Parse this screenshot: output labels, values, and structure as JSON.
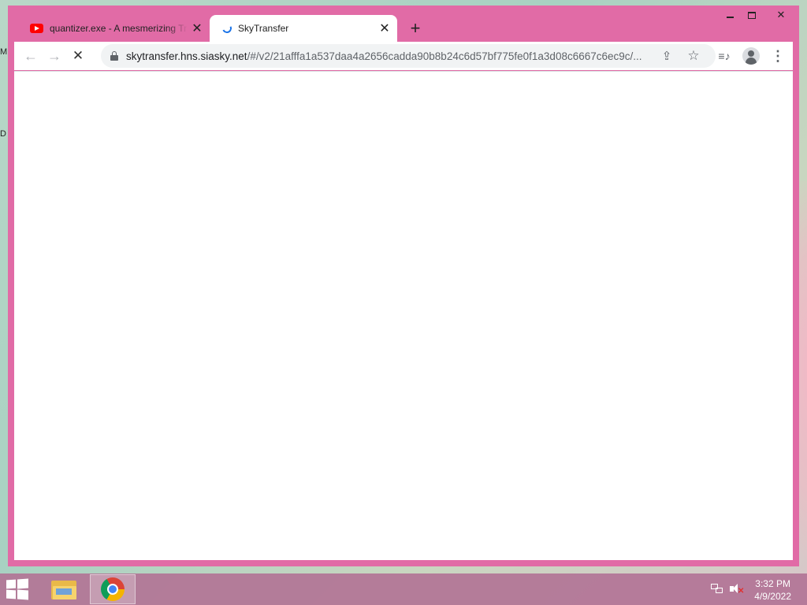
{
  "desktop": {
    "edge_letters": [
      "M",
      "D"
    ]
  },
  "browser": {
    "tabs": [
      {
        "title": "quantizer.exe - A mesmerizing Tr",
        "icon": "youtube-icon",
        "active": false
      },
      {
        "title": "SkyTransfer",
        "icon": "loading-spinner-icon",
        "active": true
      }
    ],
    "tab_close_glyph": "✕",
    "new_tab_glyph": "+",
    "toolbar": {
      "back_glyph": "←",
      "forward_glyph": "→",
      "stop_glyph": "✕",
      "url_host": "skytransfer.hns.siasky.net",
      "url_path": "/#/v2/21afffa1a537daa4a2656cadda90b8b24c6d57bf775fe0f1a3d08c6667c6ec9c/...",
      "share_glyph": "⇪",
      "star_glyph": "☆",
      "media_glyph": "≡♪",
      "menu_glyph": "⋮"
    },
    "window_controls": {
      "close_glyph": "✕"
    },
    "frame_color": "#e16ba6"
  },
  "taskbar": {
    "apps": [
      {
        "name": "File Explorer",
        "icon": "folder-icon",
        "active": false
      },
      {
        "name": "Google Chrome",
        "icon": "chrome-icon",
        "active": true
      }
    ],
    "clock": {
      "time": "3:32 PM",
      "date": "4/9/2022"
    },
    "tray_icons": [
      "network-icon",
      "volume-muted-icon"
    ]
  }
}
